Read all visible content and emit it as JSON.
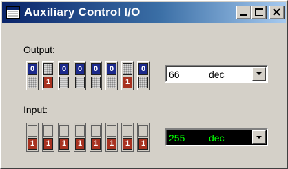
{
  "window": {
    "title": "Auxiliary Control I/O",
    "controls": [
      "minimize",
      "maximize",
      "close"
    ]
  },
  "output": {
    "label": "Output:",
    "bits": [
      0,
      1,
      0,
      0,
      0,
      0,
      1,
      0
    ],
    "value": "66",
    "format": "dec"
  },
  "input": {
    "label": "Input:",
    "bits": [
      1,
      1,
      1,
      1,
      1,
      1,
      1,
      1
    ],
    "value": "255",
    "format": "dec"
  },
  "colors": {
    "title_start": "#0a246a",
    "title_end": "#a6caf0",
    "bit_zero": "#1c2a8c",
    "bit_one": "#a83220",
    "led_text": "#00ff00",
    "led_bg": "#000000",
    "face": "#d4d0c8"
  }
}
